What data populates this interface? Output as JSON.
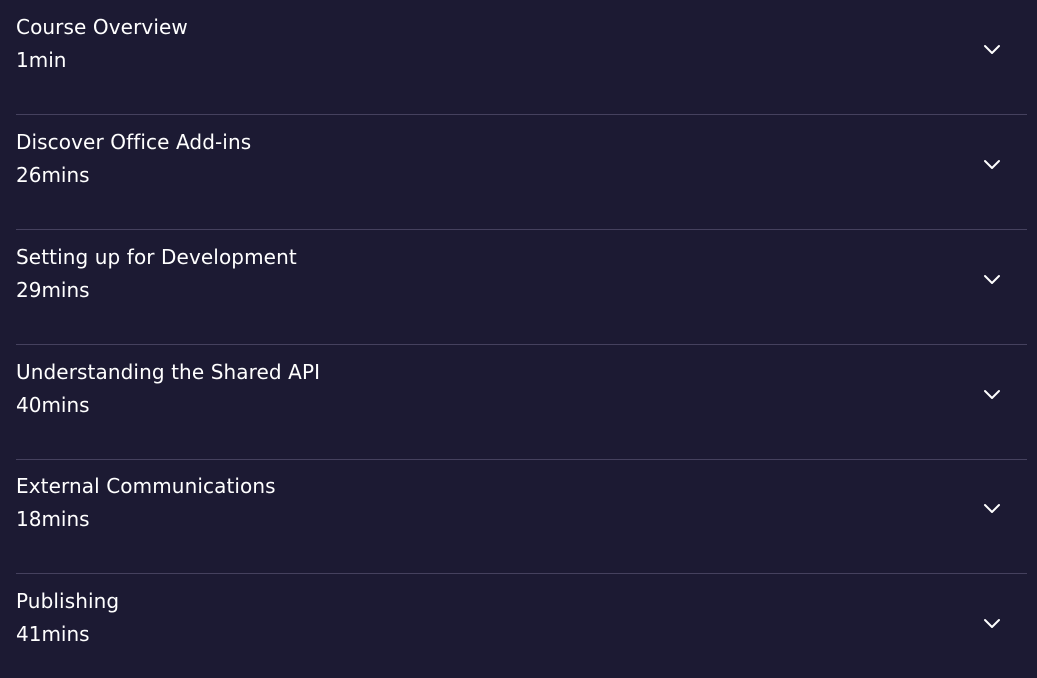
{
  "modules": [
    {
      "title": "Course Overview",
      "duration": "1min",
      "icon": "chevron-down-icon"
    },
    {
      "title": "Discover Office Add-ins",
      "duration": "26mins",
      "icon": "chevron-down-icon"
    },
    {
      "title": "Setting up for Development",
      "duration": "29mins",
      "icon": "chevron-down-icon"
    },
    {
      "title": "Understanding the Shared API",
      "duration": "40mins",
      "icon": "chevron-down-icon"
    },
    {
      "title": "External Communications",
      "duration": "18mins",
      "icon": "chevron-down-icon"
    },
    {
      "title": "Publishing",
      "duration": "41mins",
      "icon": "chevron-down-icon"
    }
  ],
  "colors": {
    "background": "#1c1a33",
    "divider": "#45415e",
    "text": "#ffffff"
  }
}
